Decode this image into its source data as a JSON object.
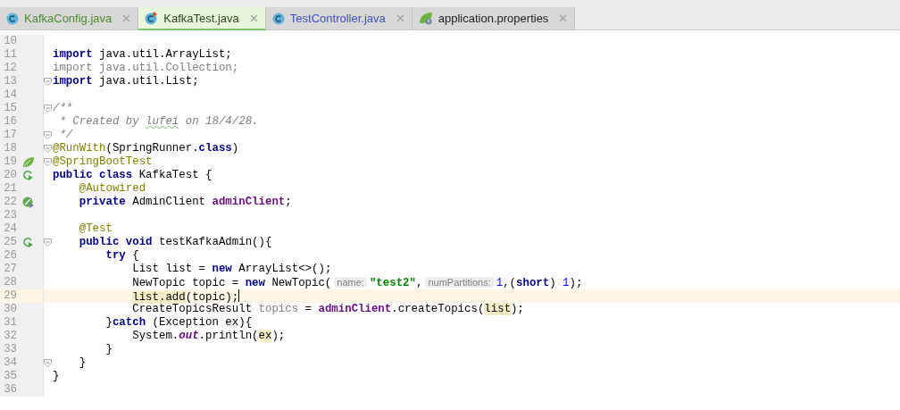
{
  "tabs": [
    {
      "label": "KafkaConfig.java",
      "kind": "class",
      "color": "#4e8a2e",
      "selected": false
    },
    {
      "label": "KafkaTest.java",
      "kind": "test",
      "color": "#2a4a1c",
      "selected": true
    },
    {
      "label": "TestController.java",
      "kind": "class",
      "color": "#3d4fb5",
      "selected": false
    },
    {
      "label": "application.properties",
      "kind": "properties",
      "color": "#222222",
      "selected": false
    }
  ],
  "lines": [
    {
      "number": "10",
      "fold": false,
      "selected": false
    },
    {
      "number": "11",
      "fold": false,
      "selected": false,
      "tokens": [
        {
          "kind": "kw",
          "text": "import"
        },
        {
          "kind": "plain",
          "text": " java.util.ArrayList;"
        }
      ]
    },
    {
      "number": "12",
      "fold": false,
      "selected": false,
      "tokens": [
        {
          "kind": "unused",
          "text": "import java.util.Collection;"
        }
      ]
    },
    {
      "number": "13",
      "fold": true,
      "selected": false,
      "tokens": [
        {
          "kind": "kw",
          "text": "import"
        },
        {
          "kind": "plain",
          "text": " java.util.List;"
        }
      ]
    },
    {
      "number": "14",
      "fold": false,
      "selected": false
    },
    {
      "number": "15",
      "fold": true,
      "selected": false,
      "tokens": [
        {
          "kind": "comment",
          "text": "/**"
        }
      ]
    },
    {
      "number": "16",
      "fold": false,
      "selected": false,
      "tokens": [
        {
          "kind": "comment",
          "text": " * Created by "
        },
        {
          "kind": "typo",
          "text": "lufei"
        },
        {
          "kind": "comment",
          "text": " on 18/4/28."
        }
      ]
    },
    {
      "number": "17",
      "fold": true,
      "selected": false,
      "tokens": [
        {
          "kind": "comment",
          "text": " */"
        }
      ]
    },
    {
      "number": "18",
      "fold": true,
      "selected": false,
      "tokens": [
        {
          "kind": "annotation",
          "text": "@RunWith"
        },
        {
          "kind": "plain",
          "text": "(SpringRunner."
        },
        {
          "kind": "kw",
          "text": "class"
        },
        {
          "kind": "plain",
          "text": ")"
        }
      ]
    },
    {
      "number": "19",
      "kind": "spring",
      "fold": true,
      "selected": false,
      "tokens": [
        {
          "kind": "annotation",
          "text": "@SpringBootTest"
        }
      ]
    },
    {
      "number": "20",
      "kind": "run",
      "fold": false,
      "selected": false,
      "tokens": [
        {
          "kind": "kw",
          "text": "public class"
        },
        {
          "kind": "plain",
          "text": " KafkaTest {"
        }
      ]
    },
    {
      "number": "21",
      "fold": false,
      "selected": false,
      "tokens": [
        {
          "kind": "annotation",
          "text": "    @Autowired"
        }
      ]
    },
    {
      "number": "22",
      "kind": "bean",
      "fold": false,
      "selected": false,
      "tokens": [
        {
          "kind": "kw",
          "text": "    private"
        },
        {
          "kind": "plain",
          "text": " AdminClient "
        },
        {
          "kind": "field",
          "text": "adminClient"
        },
        {
          "kind": "plain",
          "text": ";"
        }
      ]
    },
    {
      "number": "23",
      "fold": false,
      "selected": false
    },
    {
      "number": "24",
      "fold": false,
      "selected": false,
      "tokens": [
        {
          "kind": "annotation",
          "text": "    @Test"
        }
      ]
    },
    {
      "number": "25",
      "kind": "run",
      "fold": true,
      "selected": false,
      "tokens": [
        {
          "kind": "kw",
          "text": "    public void"
        },
        {
          "kind": "plain",
          "text": " testKafkaAdmin(){"
        }
      ]
    },
    {
      "number": "26",
      "fold": false,
      "selected": false,
      "tokens": [
        {
          "kind": "kw",
          "text": "        try"
        },
        {
          "kind": "plain",
          "text": " {"
        }
      ]
    },
    {
      "number": "27",
      "fold": false,
      "selected": false,
      "tokens": [
        {
          "kind": "plain",
          "text": "            List list = "
        },
        {
          "kind": "kw",
          "text": "new"
        },
        {
          "kind": "plain",
          "text": " ArrayList<>();"
        }
      ]
    },
    {
      "number": "28",
      "fold": false,
      "selected": false,
      "tokens": [
        {
          "kind": "plain",
          "text": "            NewTopic topic = "
        },
        {
          "kind": "kw",
          "text": "new"
        },
        {
          "kind": "plain",
          "text": " NewTopic("
        },
        {
          "kind": "hint",
          "text": "name:"
        },
        {
          "kind": "string",
          "text": "\"test2\""
        },
        {
          "kind": "plain",
          "text": ","
        },
        {
          "kind": "hint",
          "text": "numPartitions:"
        },
        {
          "kind": "number",
          "text": "1"
        },
        {
          "kind": "plain",
          "text": ",("
        },
        {
          "kind": "kw",
          "text": "short"
        },
        {
          "kind": "plain",
          "text": ") "
        },
        {
          "kind": "number",
          "text": "1"
        },
        {
          "kind": "plain",
          "text": ");"
        }
      ]
    },
    {
      "number": "29",
      "fold": false,
      "selected": true,
      "tokens": [
        {
          "kind": "usage",
          "text": "            list.add"
        },
        {
          "kind": "plain",
          "text": "(topic);"
        }
      ]
    },
    {
      "number": "30",
      "fold": false,
      "selected": false,
      "tokens": [
        {
          "kind": "plain",
          "text": "            CreateTopicsResult "
        },
        {
          "kind": "unused",
          "text": "topics"
        },
        {
          "kind": "plain",
          "text": " = "
        },
        {
          "kind": "field",
          "text": "adminClient"
        },
        {
          "kind": "plain",
          "text": ".createTopics("
        },
        {
          "kind": "usage",
          "text": "list"
        },
        {
          "kind": "plain",
          "text": ");"
        }
      ]
    },
    {
      "number": "31",
      "fold": false,
      "selected": false,
      "tokens": [
        {
          "kind": "plain",
          "text": "        }"
        },
        {
          "kind": "kw",
          "text": "catch"
        },
        {
          "kind": "plain",
          "text": " (Exception ex){"
        }
      ]
    },
    {
      "number": "32",
      "fold": false,
      "selected": false,
      "tokens": [
        {
          "kind": "plain",
          "text": "            System."
        },
        {
          "kind": "static",
          "text": "out"
        },
        {
          "kind": "plain",
          "text": ".println("
        },
        {
          "kind": "usage",
          "text": "ex"
        },
        {
          "kind": "plain",
          "text": ");"
        }
      ]
    },
    {
      "number": "33",
      "fold": false,
      "selected": false,
      "tokens": [
        {
          "kind": "plain",
          "text": "        }"
        }
      ]
    },
    {
      "number": "34",
      "fold": true,
      "selected": false,
      "tokens": [
        {
          "kind": "plain",
          "text": "    }"
        }
      ]
    },
    {
      "number": "35",
      "fold": false,
      "selected": false,
      "tokens": [
        {
          "kind": "plain",
          "text": "}"
        }
      ]
    },
    {
      "number": "36",
      "fold": false,
      "selected": false
    }
  ]
}
